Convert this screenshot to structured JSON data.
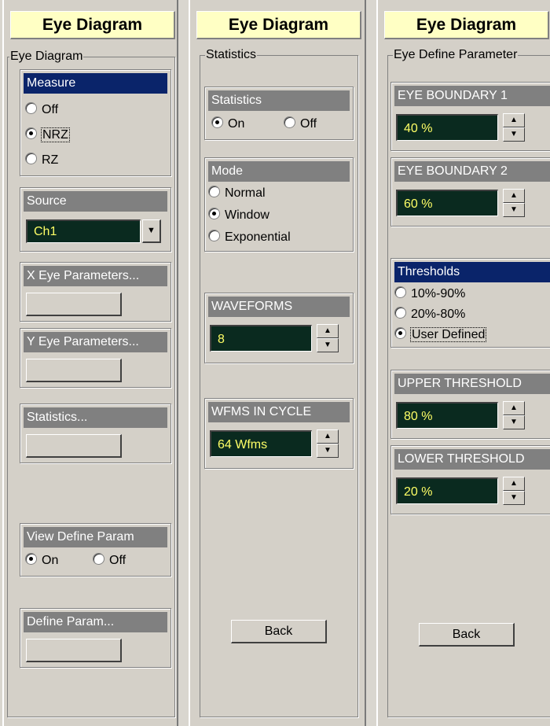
{
  "left": {
    "title": "Eye Diagram",
    "group_legend": "Eye Diagram",
    "measure": {
      "header": "Measure",
      "options": [
        "Off",
        "NRZ",
        "RZ"
      ],
      "selected": "NRZ"
    },
    "source": {
      "header": "Source",
      "value": "Ch1"
    },
    "x_eye": {
      "header": "X Eye Parameters..."
    },
    "y_eye": {
      "header": "Y Eye Parameters..."
    },
    "statistics": {
      "header": "Statistics..."
    },
    "view_define": {
      "header": "View Define Param",
      "on": "On",
      "off": "Off",
      "selected": "On"
    },
    "define_param": {
      "header": "Define Param..."
    }
  },
  "middle": {
    "title": "Eye Diagram",
    "group_legend": "Statistics",
    "statistics": {
      "header": "Statistics",
      "on": "On",
      "off": "Off",
      "selected": "On"
    },
    "mode": {
      "header": "Mode",
      "options": [
        "Normal",
        "Window",
        "Exponential"
      ],
      "selected": "Window"
    },
    "waveforms": {
      "header": "WAVEFORMS",
      "value": "8"
    },
    "wfms_in_cycle": {
      "header": "WFMS IN CYCLE",
      "value": "64 Wfms"
    },
    "back_label": "Back"
  },
  "right": {
    "title": "Eye Diagram",
    "group_legend": "Eye Define Parameter",
    "eye_boundary_1": {
      "header": "EYE BOUNDARY 1",
      "value": "40 %"
    },
    "eye_boundary_2": {
      "header": "EYE BOUNDARY 2",
      "value": "60 %"
    },
    "thresholds": {
      "header": "Thresholds",
      "options": [
        "10%-90%",
        "20%-80%",
        "User Defined"
      ],
      "selected": "User Defined"
    },
    "upper_threshold": {
      "header": "UPPER THRESHOLD",
      "value": "80 %"
    },
    "lower_threshold": {
      "header": "LOWER THRESHOLD",
      "value": "20 %"
    },
    "back_label": "Back"
  },
  "colors": {
    "title_bg": "#ffffc4",
    "header_gray": "#808080",
    "header_navy": "#0a246a",
    "field_bg": "#0a2a1f",
    "field_text": "#ffff66"
  },
  "icons": {
    "spin_up": "spin-up-arrow-icon",
    "spin_down": "spin-down-arrow-icon",
    "combo": "dropdown-arrow-icon"
  }
}
